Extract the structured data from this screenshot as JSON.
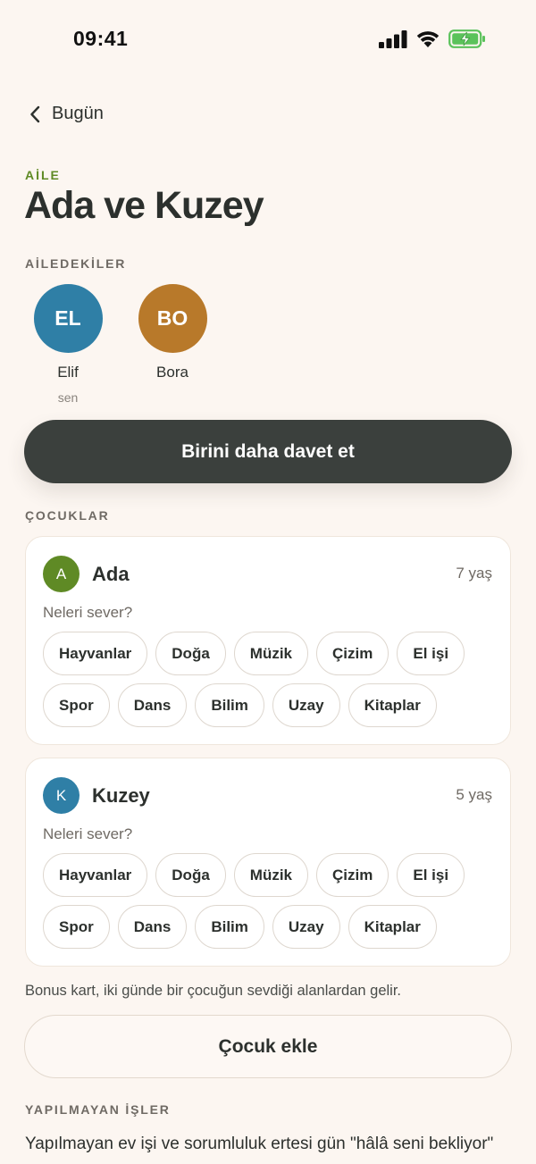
{
  "status": {
    "time": "09:41"
  },
  "nav": {
    "back_label": "Bugün"
  },
  "header": {
    "eyebrow": "AİLE",
    "title": "Ada ve Kuzey"
  },
  "members_section": {
    "label": "AİLEDEKİLER",
    "members": [
      {
        "initials": "EL",
        "name": "Elif",
        "sub": "sen",
        "color": "#2f7fa6"
      },
      {
        "initials": "BO",
        "name": "Bora",
        "sub": "",
        "color": "#b8792a"
      }
    ],
    "invite_label": "Birini daha davet et"
  },
  "children_section": {
    "label": "ÇOCUKLAR",
    "children": [
      {
        "initial": "A",
        "name": "Ada",
        "age": "7 yaş",
        "color": "#5f8a25",
        "question": "Neleri sever?",
        "interests": [
          "Hayvanlar",
          "Doğa",
          "Müzik",
          "Çizim",
          "El işi",
          "Spor",
          "Dans",
          "Bilim",
          "Uzay",
          "Kitaplar"
        ]
      },
      {
        "initial": "K",
        "name": "Kuzey",
        "age": "5 yaş",
        "color": "#2f7fa6",
        "question": "Neleri sever?",
        "interests": [
          "Hayvanlar",
          "Doğa",
          "Müzik",
          "Çizim",
          "El işi",
          "Spor",
          "Dans",
          "Bilim",
          "Uzay",
          "Kitaplar"
        ]
      }
    ],
    "note": "Bonus kart, iki günde bir çocuğun sevdiği alanlardan gelir.",
    "add_child_label": "Çocuk ekle"
  },
  "undone_section": {
    "label": "YAPILMAYAN İŞLER",
    "text": "Yapılmayan ev işi ve sorumluluk ertesi gün \"hâlâ seni bekliyor\""
  }
}
